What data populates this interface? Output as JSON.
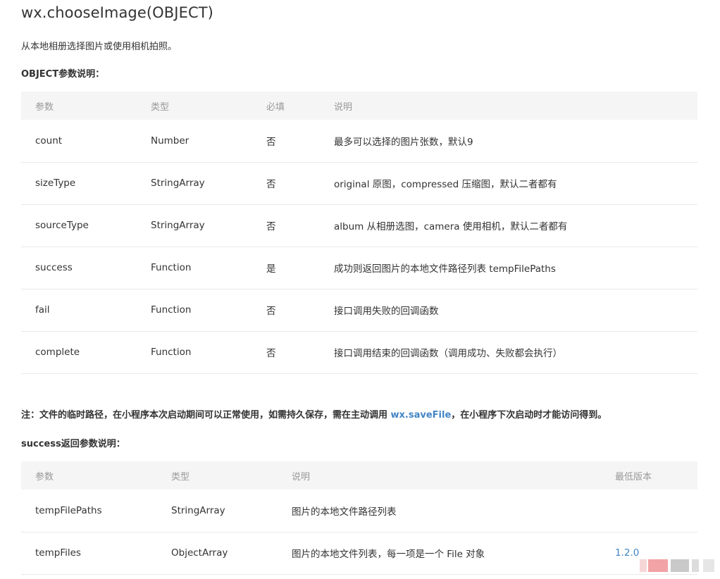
{
  "page": {
    "title": "wx.chooseImage(OBJECT)",
    "description": "从本地相册选择图片或使用相机拍照。",
    "object_label": "OBJECT参数说明：",
    "note_prefix": "注：文件的临时路径，在小程序本次启动期间可以正常使用，如需持久保存，需在主动调用 ",
    "note_link": "wx.saveFile",
    "note_suffix": "，在小程序下次启动时才能访问得到。",
    "success_label": "success返回参数说明："
  },
  "object_table": {
    "headers": [
      "参数",
      "类型",
      "必填",
      "说明"
    ],
    "rows": [
      [
        "count",
        "Number",
        "否",
        "最多可以选择的图片张数，默认9"
      ],
      [
        "sizeType",
        "StringArray",
        "否",
        "original 原图，compressed 压缩图，默认二者都有"
      ],
      [
        "sourceType",
        "StringArray",
        "否",
        "album 从相册选图，camera 使用相机，默认二者都有"
      ],
      [
        "success",
        "Function",
        "是",
        "成功则返回图片的本地文件路径列表 tempFilePaths"
      ],
      [
        "fail",
        "Function",
        "否",
        "接口调用失败的回调函数"
      ],
      [
        "complete",
        "Function",
        "否",
        "接口调用结束的回调函数（调用成功、失败都会执行）"
      ]
    ]
  },
  "success_table": {
    "headers": [
      "参数",
      "类型",
      "说明",
      "最低版本"
    ],
    "rows": [
      [
        "tempFilePaths",
        "StringArray",
        "图片的本地文件路径列表",
        ""
      ],
      [
        "tempFiles",
        "ObjectArray",
        "图片的本地文件列表，每一项是一个 File 对象",
        "1.2.0"
      ]
    ]
  },
  "colors": {
    "link": "#4285c4",
    "header_bg": "#f5f5f6",
    "header_text": "#999999",
    "body_text": "#333333",
    "row_border": "#e9e9e9"
  }
}
